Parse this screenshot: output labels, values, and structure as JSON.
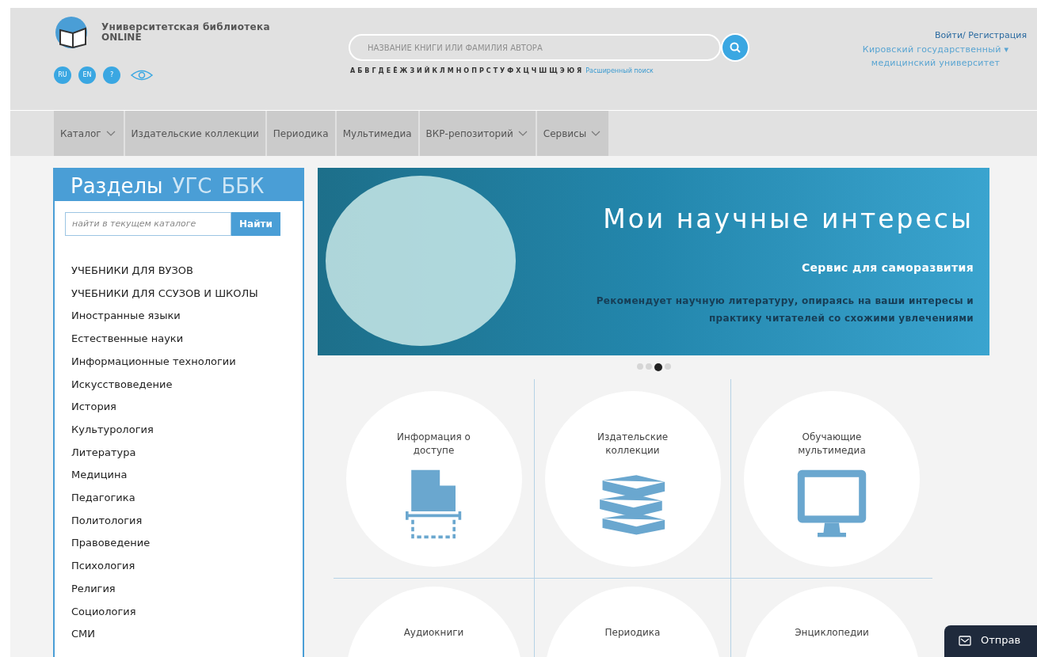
{
  "header": {
    "logo_title": "Университетская библиотека",
    "logo_subtitle": "ONLINE",
    "languages": [
      {
        "label": "RU"
      },
      {
        "label": "EN"
      },
      {
        "label": "?"
      }
    ],
    "search": {
      "placeholder": "НАЗВАНИЕ КНИГИ ИЛИ ФАМИЛИЯ АВТОРА"
    },
    "alphabet": [
      "А",
      "Б",
      "В",
      "Г",
      "Д",
      "Е",
      "Ё",
      "Ж",
      "З",
      "И",
      "Й",
      "К",
      "Л",
      "М",
      "Н",
      "О",
      "П",
      "Р",
      "С",
      "Т",
      "У",
      "Ф",
      "Х",
      "Ц",
      "Ч",
      "Ш",
      "Щ",
      "Э",
      "Ю",
      "Я"
    ],
    "advanced_search": "Расширенный поиск",
    "login": "Войти/ Регистрация",
    "organization": "Кировский государственный ▾ медицинский университет"
  },
  "nav": [
    {
      "label": "Каталог",
      "dropdown": true
    },
    {
      "label": "Издательские коллекции",
      "dropdown": false
    },
    {
      "label": "Периодика",
      "dropdown": false
    },
    {
      "label": "Мультимедиа",
      "dropdown": false
    },
    {
      "label": "ВКР-репозиторий",
      "dropdown": true
    },
    {
      "label": "Сервисы",
      "dropdown": true
    }
  ],
  "sidebar": {
    "tabs": [
      {
        "label": "Разделы",
        "selected": true
      },
      {
        "label": "УГС",
        "selected": false
      },
      {
        "label": "ББК",
        "selected": false
      }
    ],
    "search": {
      "placeholder": "найти в текущем каталоге",
      "button": "Найти"
    },
    "items": [
      "УЧЕБНИКИ ДЛЯ ВУЗОВ",
      "УЧЕБНИКИ ДЛЯ ССУЗОВ И ШКОЛЫ",
      "Иностранные языки",
      "Естественные науки",
      "Информационные технологии",
      "Искусствоведение",
      "История",
      "Культурология",
      "Литература",
      "Медицина",
      "Педагогика",
      "Политология",
      "Правоведение",
      "Психология",
      "Религия",
      "Социология",
      "СМИ"
    ]
  },
  "banner": {
    "title": "Мои научные интересы",
    "subtitle": "Сервис для саморазвития",
    "text": "Рекомендует научную литературу, опираясь на ваши интересы и практику читателей со схожими увлечениями"
  },
  "carousel_dots": [
    {
      "selected": false
    },
    {
      "selected": false
    },
    {
      "selected": true
    },
    {
      "selected": false
    }
  ],
  "tiles": [
    {
      "label": "Информация о доступе",
      "kind": "document"
    },
    {
      "label": "Издательские коллекции",
      "kind": "books"
    },
    {
      "label": "Обучающие мультимедиа",
      "kind": "monitor"
    },
    {
      "label": "Аудиокниги",
      "kind": "none"
    },
    {
      "label": "Периодика",
      "kind": "none"
    },
    {
      "label": "Энциклопедии",
      "kind": "none"
    }
  ],
  "feedback_button": "Отправ"
}
